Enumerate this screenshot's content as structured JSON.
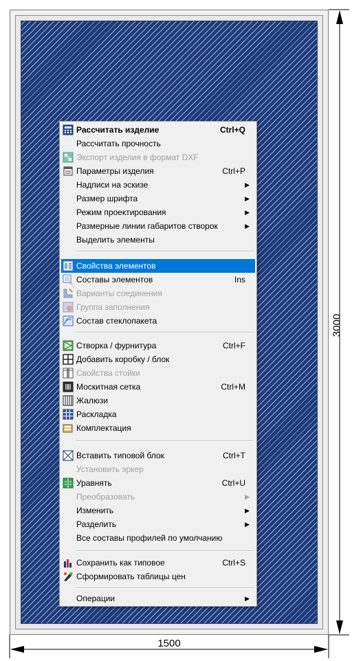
{
  "dimensions": {
    "width_label": "1500",
    "height_label": "3000"
  },
  "menu": {
    "items": [
      {
        "label": "Рассчитать изделие",
        "shortcut": "Ctrl+Q",
        "icon": "calculator-icon",
        "bold": true
      },
      {
        "label": "Рассчитать прочность",
        "shortcut": "",
        "icon": ""
      },
      {
        "label": "Экспорт изделия в формат DXF",
        "shortcut": "",
        "icon": "export-dxf-icon",
        "disabled": true
      },
      {
        "label": "Параметры изделия",
        "shortcut": "Ctrl+P",
        "icon": "parameters-icon"
      },
      {
        "label": "Надписи на эскизе",
        "shortcut": "",
        "submenu": true
      },
      {
        "label": "Размер шрифта",
        "shortcut": "",
        "submenu": true
      },
      {
        "label": "Режим проектирования",
        "shortcut": "",
        "submenu": true
      },
      {
        "label": "Размерные линии габаритов створок",
        "shortcut": "",
        "submenu": true
      },
      {
        "label": "Выделить элементы",
        "shortcut": ""
      },
      {
        "label": "Свойства элементов",
        "shortcut": "",
        "icon": "element-properties-icon",
        "selected": true
      },
      {
        "label": "Составы элементов",
        "shortcut": "Ins",
        "icon": "element-compositions-icon"
      },
      {
        "label": "Варианты соединения",
        "shortcut": "",
        "icon": "connection-variants-icon",
        "disabled": true
      },
      {
        "label": "Группа заполнения",
        "shortcut": "",
        "icon": "fill-group-icon",
        "disabled": true
      },
      {
        "label": "Состав стеклопакета",
        "shortcut": "",
        "icon": "glass-unit-icon"
      },
      {
        "label": "Створка  /  фурнитура",
        "shortcut": "Ctrl+F",
        "icon": "sash-icon"
      },
      {
        "label": "Добавить коробку / блок",
        "shortcut": "",
        "icon": "add-frame-icon"
      },
      {
        "label": "Свойства стойки",
        "shortcut": "",
        "icon": "mullion-properties-icon",
        "disabled": true
      },
      {
        "label": "Москитная  сетка",
        "shortcut": "Ctrl+M",
        "icon": "mosquito-net-icon"
      },
      {
        "label": "Жалюзи",
        "shortcut": "",
        "icon": "blinds-icon"
      },
      {
        "label": "Раскладка",
        "shortcut": "",
        "icon": "grid-bars-icon"
      },
      {
        "label": "Комплектация",
        "shortcut": "",
        "icon": "equipment-icon"
      },
      {
        "label": "Вставить типовой блок",
        "shortcut": "Ctrl+T",
        "icon": "insert-block-icon"
      },
      {
        "label": "Установить эркер",
        "shortcut": "",
        "disabled": true
      },
      {
        "label": "Уравнять",
        "shortcut": "Ctrl+U",
        "icon": "equalize-icon"
      },
      {
        "label": "Преобразовать",
        "shortcut": "",
        "submenu": true,
        "disabled": true
      },
      {
        "label": "Изменить",
        "shortcut": "",
        "submenu": true
      },
      {
        "label": "Разделить",
        "shortcut": "",
        "submenu": true
      },
      {
        "label": "Все составы профилей по умолчанию",
        "shortcut": ""
      },
      {
        "label": "Сохранить как типовое",
        "shortcut": "Ctrl+S",
        "icon": "save-typical-icon"
      },
      {
        "label": "Сформировать таблицы цен",
        "shortcut": "",
        "icon": "price-tables-icon"
      },
      {
        "label": "Операции",
        "shortcut": "",
        "submenu": true
      }
    ]
  },
  "colors": {
    "glass": "#1d3a7a",
    "selection": "#0078d7"
  }
}
